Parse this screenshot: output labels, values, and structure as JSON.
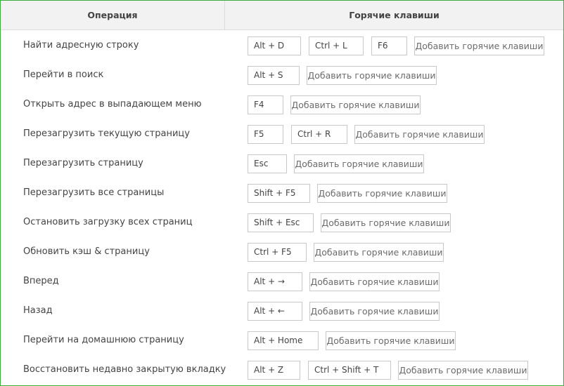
{
  "table": {
    "headers": {
      "operation": "Операция",
      "hotkeys": "Горячие клавиши"
    },
    "add_label": "Добавить горячие клавиши",
    "rows": [
      {
        "operation": "Найти адресную строку",
        "keys": [
          "Alt + D",
          "Ctrl + L",
          "F6"
        ]
      },
      {
        "operation": "Перейти в поиск",
        "keys": [
          "Alt + S"
        ]
      },
      {
        "operation": "Открыть адрес в выпадающем меню",
        "keys": [
          "F4"
        ]
      },
      {
        "operation": "Перезагрузить текущую страницу",
        "keys": [
          "F5",
          "Ctrl + R"
        ]
      },
      {
        "operation": "Перезагрузить страницу",
        "keys": [
          "Esc"
        ]
      },
      {
        "operation": "Перезагрузить все страницы",
        "keys": [
          "Shift + F5"
        ]
      },
      {
        "operation": "Остановить загрузку всех страниц",
        "keys": [
          "Shift + Esc"
        ]
      },
      {
        "operation": "Обновить кэш & страницу",
        "keys": [
          "Ctrl + F5"
        ]
      },
      {
        "operation": "Вперед",
        "keys": [
          "Alt + →"
        ]
      },
      {
        "operation": "Назад",
        "keys": [
          "Alt + ←"
        ]
      },
      {
        "operation": "Перейти на домашнюю страницу",
        "keys": [
          "Alt + Home"
        ]
      },
      {
        "operation": "Восстановить недавно закрытую вкладку",
        "keys": [
          "Alt + Z",
          "Ctrl + Shift + T"
        ]
      }
    ]
  },
  "colors": {
    "border_accent": "#3cad3c",
    "header_bg": "#f2f2f2"
  }
}
